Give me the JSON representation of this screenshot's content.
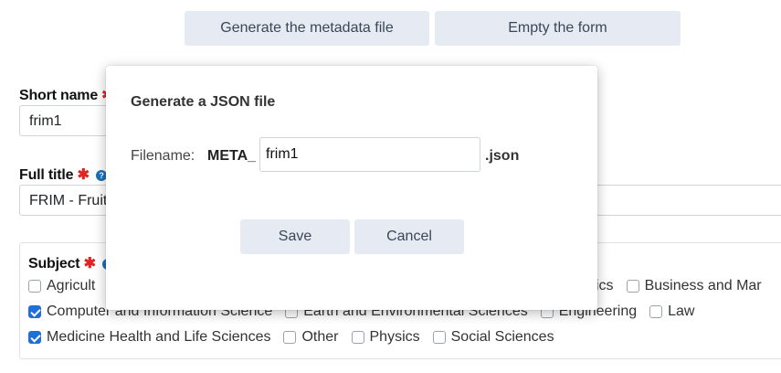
{
  "toolbar": {
    "generate_label": "Generate the metadata file",
    "empty_label": "Empty the form"
  },
  "form": {
    "short_name": {
      "label": "Short name",
      "value": "frim1"
    },
    "full_title": {
      "label": "Full title",
      "value": "FRIM - Fruit"
    },
    "subject": {
      "label": "Subject",
      "row1": [
        {
          "label": "Agricult",
          "checked": false
        },
        {
          "label": "ics",
          "checked": false
        },
        {
          "label": "Business and Mar",
          "checked": false
        }
      ],
      "row2": [
        {
          "label": "Computer and Information Science",
          "checked": true
        },
        {
          "label": "Earth and Environmental Sciences",
          "checked": false
        },
        {
          "label": "Engineering",
          "checked": false
        },
        {
          "label": "Law",
          "checked": false
        }
      ],
      "row3": [
        {
          "label": "Medicine Health and Life Sciences",
          "checked": true
        },
        {
          "label": "Other",
          "checked": false
        },
        {
          "label": "Physics",
          "checked": false
        },
        {
          "label": "Social Sciences",
          "checked": false
        }
      ]
    },
    "required_mark": "✱",
    "help_glyph": "?"
  },
  "modal": {
    "title": "Generate a JSON file",
    "filename_label": "Filename:",
    "prefix": "META_",
    "filename_value": "frim1",
    "suffix": ".json",
    "save_label": "Save",
    "cancel_label": "Cancel"
  },
  "colors": {
    "button_bg": "#e6ebf3",
    "required": "#e02424",
    "checkbox_checked": "#1e6fd9",
    "help_badge": "#1c6fb8"
  }
}
